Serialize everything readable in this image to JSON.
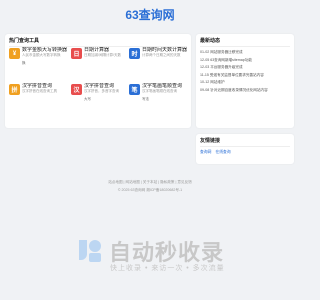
{
  "site": {
    "logo": "63查询网"
  },
  "tools_panel": {
    "title": "热门查询工具",
    "items": [
      {
        "name": "数字金额大写转换器",
        "desc": "人民币金额大写数字转换",
        "tag": "换",
        "icon_text": "¥",
        "icon_color": "#f0a020"
      },
      {
        "name": "日期计算器",
        "desc": "日期加减/间隔计算/天数",
        "tag": "",
        "icon_text": "日",
        "icon_color": "#e84d4d"
      },
      {
        "name": "日期时间天数计算器",
        "desc": "计算两个日期之间的天数",
        "tag": "",
        "icon_text": "时",
        "icon_color": "#2b6fd6"
      },
      {
        "name": "汉字拼音查询",
        "desc": "汉字拼音在线查询工具",
        "tag": "",
        "icon_text": "拼",
        "icon_color": "#f0a020"
      },
      {
        "name": "汉字拼音查询",
        "desc": "汉字拼音，多音字查询",
        "tag": "大写",
        "icon_text": "汉",
        "icon_color": "#e84d4d"
      },
      {
        "name": "汉字笔画笔顺查询",
        "desc": "汉字笔画笔顺在线查询",
        "tag": "写法",
        "icon_text": "笔",
        "icon_color": "#2b6fd6"
      }
    ]
  },
  "news_panel": {
    "title": "最新动态",
    "items": [
      "01-02 网站服务器迁移完成",
      "12-05 63查询网新增sitemap功能",
      "12-03 平台服务器升级完成",
      "11-15 受邀有关监督单位要求完善站内容",
      "10-12 网站维护",
      "09-08 针对近期百度收录情况优化网站内容"
    ]
  },
  "links_panel": {
    "title": "友情链接",
    "items": [
      "查询网",
      "在线查询"
    ]
  },
  "footer": {
    "line1": "站点地图 | 网站地图 | 关于本站 | 隐私政策 | 意见反馈",
    "line2": "© 2025 63查询网 湘ICP备18020682号-1"
  },
  "watermark": {
    "text": "自动秒收录",
    "sub": "快上收录 • 来访一次 • 多次流量",
    "mark_color": "#bcd6f2"
  }
}
